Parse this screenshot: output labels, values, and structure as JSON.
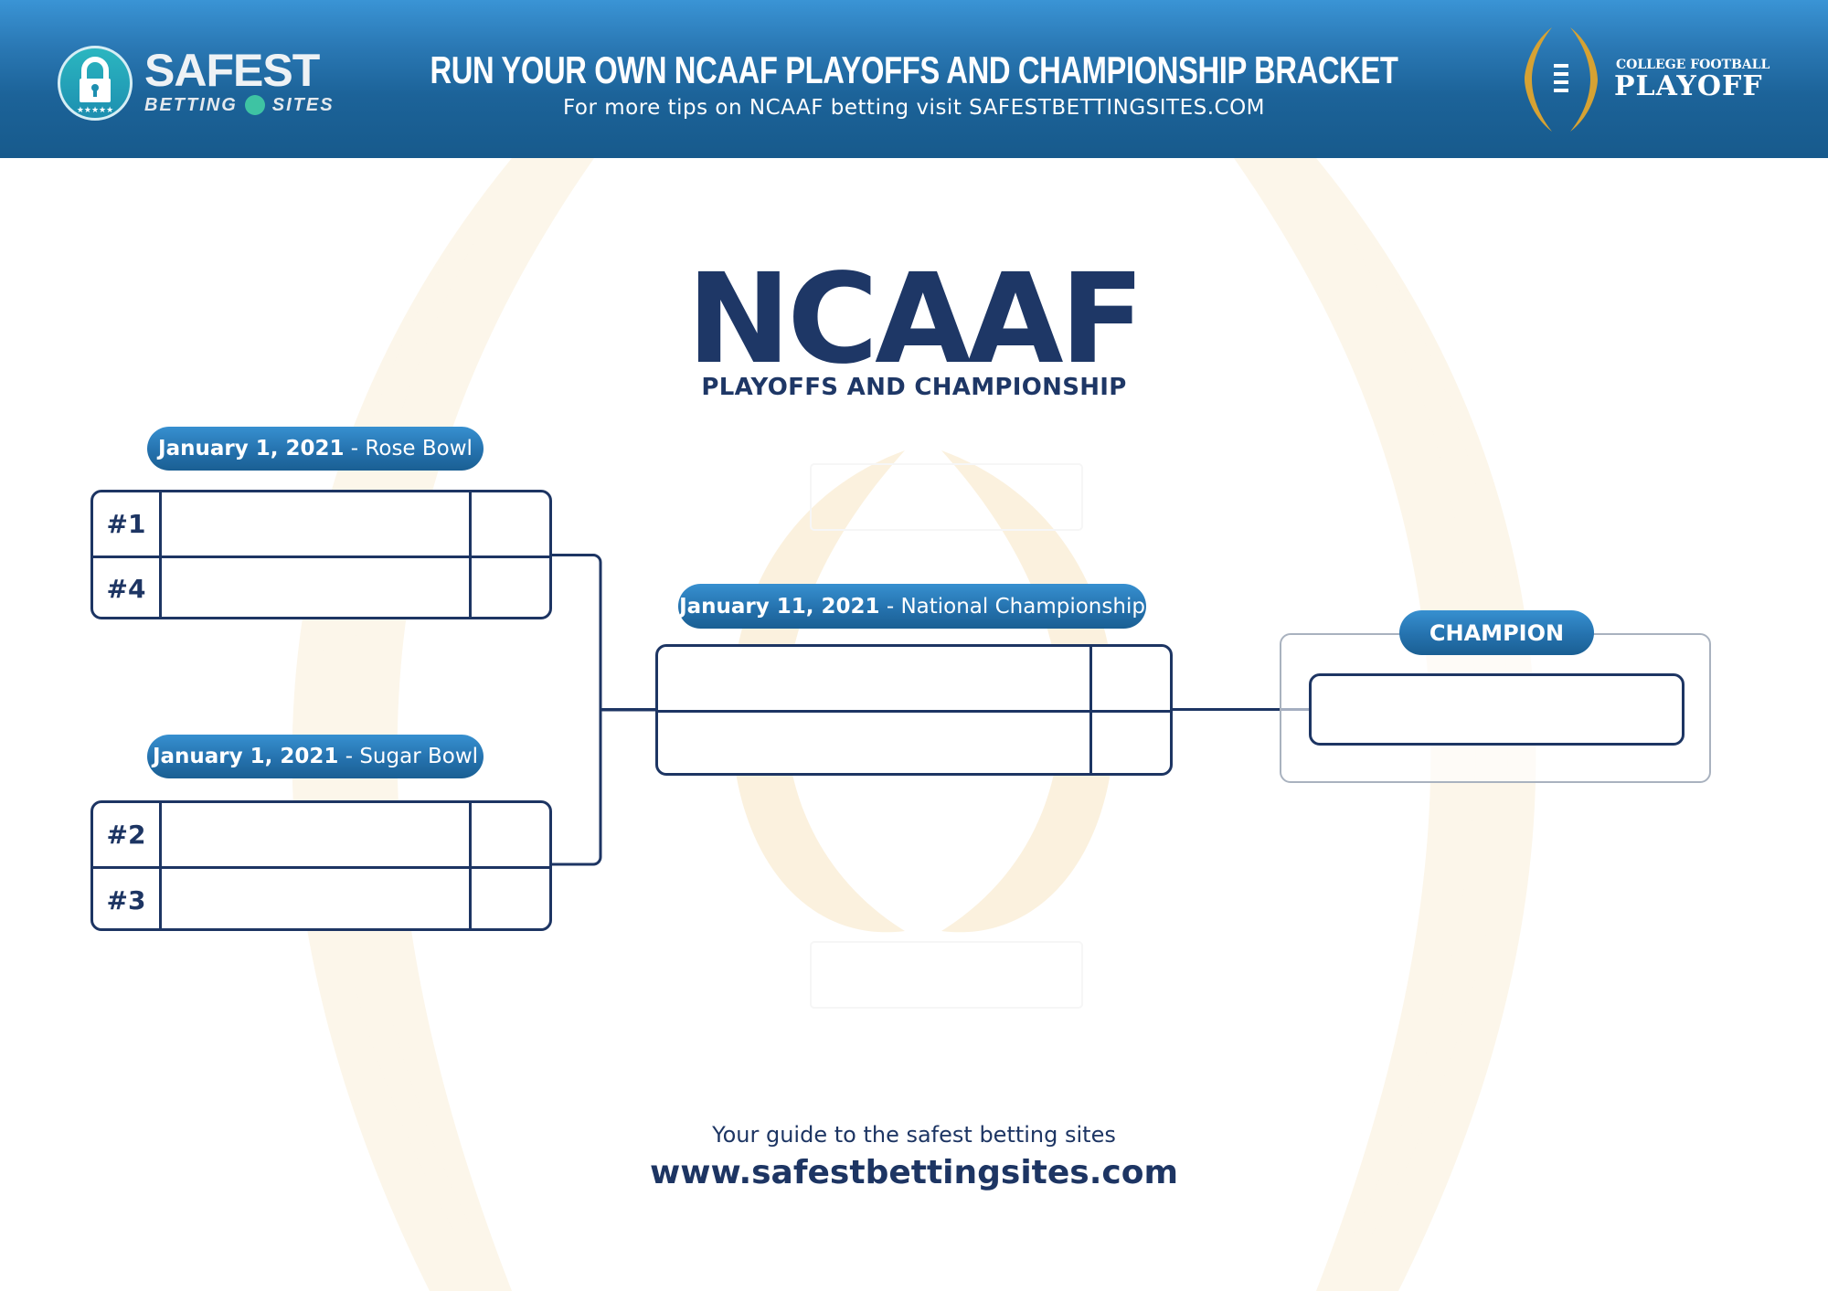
{
  "header": {
    "brand": {
      "name": "SAFEST",
      "sub_left": "BETTING",
      "sub_right": "SITES"
    },
    "title": "RUN YOUR OWN NCAAF PLAYOFFS AND CHAMPIONSHIP BRACKET",
    "subtitle": "For more tips on NCAAF betting visit SAFESTBETTINGSITES.COM",
    "partner_logo": {
      "small": "COLLEGE FOOTBALL",
      "big": "PLAYOFF"
    }
  },
  "main": {
    "title": "NCAAF",
    "subtitle": "PLAYOFFS AND CHAMPIONSHIP"
  },
  "bracket": {
    "semifinals": [
      {
        "date": "January 1, 2021",
        "bowl": " - Rose Bowl",
        "teams": [
          {
            "seed": "#1",
            "name": "",
            "score": ""
          },
          {
            "seed": "#4",
            "name": "",
            "score": ""
          }
        ]
      },
      {
        "date": "January 1, 2021",
        "bowl": " - Sugar Bowl",
        "teams": [
          {
            "seed": "#2",
            "name": "",
            "score": ""
          },
          {
            "seed": "#3",
            "name": "",
            "score": ""
          }
        ]
      }
    ],
    "final": {
      "date": "January 11, 2021",
      "bowl": " - National Championship",
      "teams": [
        {
          "name": "",
          "score": ""
        },
        {
          "name": "",
          "score": ""
        }
      ]
    },
    "champion": {
      "label": "CHAMPION",
      "name": ""
    }
  },
  "footer": {
    "tagline": "Your guide to the safest betting sites",
    "url": "www.safestbettingsites.com"
  },
  "colors": {
    "navy": "#1d3563",
    "header_top": "#3a94d5",
    "header_bottom": "#175a8c",
    "gold": "#d6a233",
    "teal": "#2bb6c0",
    "watermark": "#fdf8ee"
  }
}
